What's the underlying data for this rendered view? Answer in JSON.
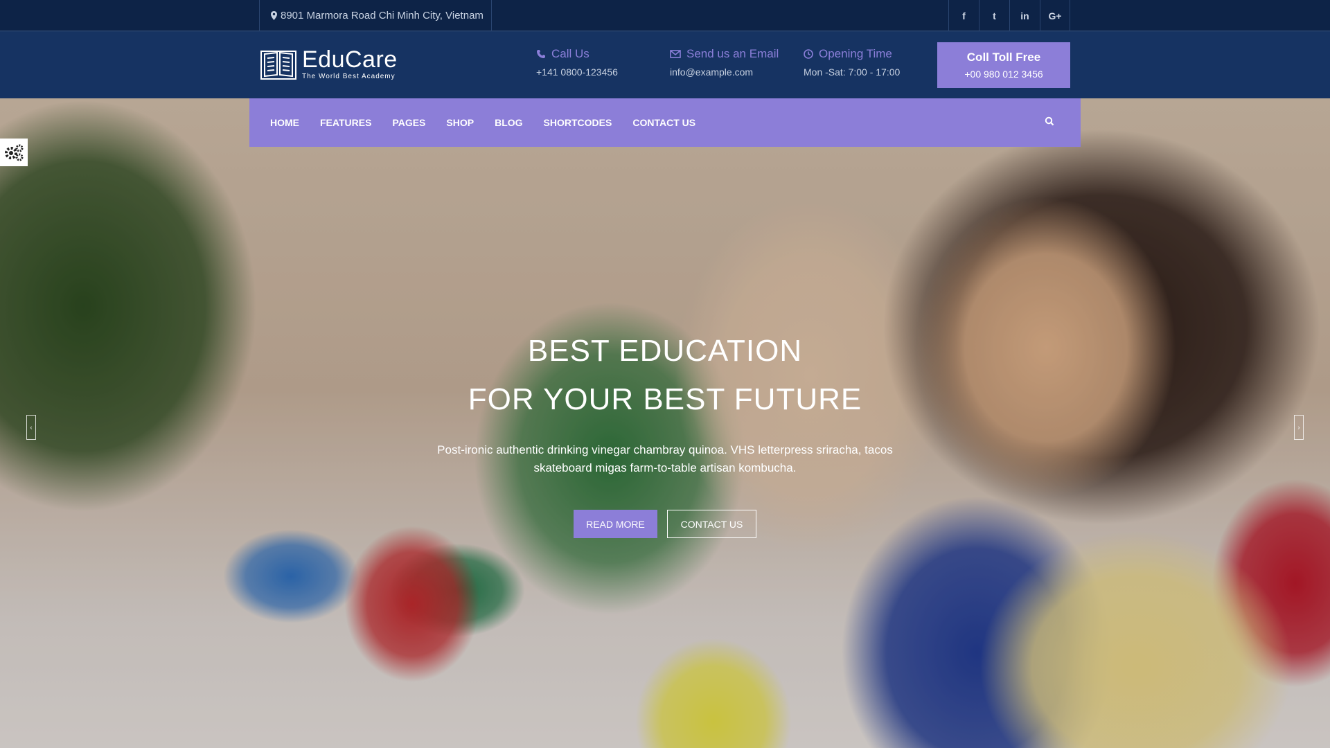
{
  "topbar": {
    "address": "8901 Marmora Road Chi Minh City, Vietnam",
    "social": [
      {
        "label": "f",
        "icon": "facebook-icon"
      },
      {
        "label": "t",
        "icon": "twitter-icon"
      },
      {
        "label": "in",
        "icon": "linkedin-icon"
      },
      {
        "label": "G+",
        "icon": "google-plus-icon"
      }
    ]
  },
  "header": {
    "logo_name": "EduCare",
    "logo_tagline": "The World Best Academy",
    "call": {
      "title": "Call Us",
      "value": "+141 0800-123456"
    },
    "email": {
      "title": "Send us an Email",
      "value": "info@example.com"
    },
    "opening": {
      "title": "Opening Time",
      "value": "Mon -Sat: 7:00 - 17:00"
    },
    "toll": {
      "title": "Coll Toll Free",
      "value": "+00 980 012 3456"
    }
  },
  "nav": {
    "items": [
      "HOME",
      "FEATURES",
      "PAGES",
      "SHOP",
      "BLOG",
      "SHORTCODES",
      "CONTACT US"
    ]
  },
  "hero": {
    "title_line1": "BEST EDUCATION",
    "title_line2": "FOR YOUR BEST FUTURE",
    "description_line1": "Post-ironic authentic drinking vinegar chambray quinoa. VHS letterpress sriracha, tacos",
    "description_line2": "skateboard migas farm-to-table artisan kombucha.",
    "read_more": "READ MORE",
    "contact_us": "CONTACT US"
  },
  "colors": {
    "accent": "#8c7ed8",
    "header_bg": "#163362",
    "topbar_bg": "#0d2347"
  }
}
